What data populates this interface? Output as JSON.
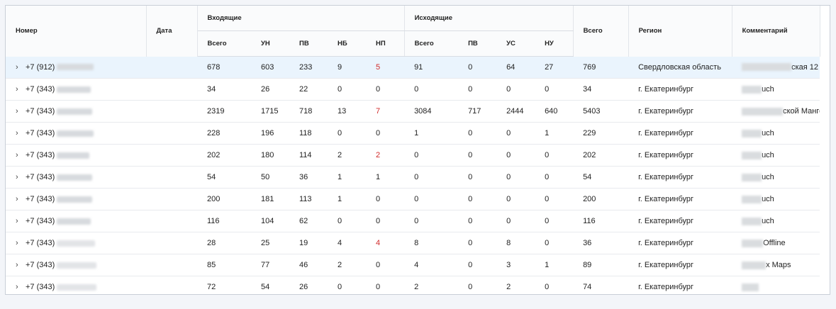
{
  "columns": {
    "number": "Номер",
    "date": "Дата",
    "incoming": "Входящие",
    "outgoing": "Исходящие",
    "total": "Всего",
    "region": "Регион",
    "comment": "Комментарий",
    "in_sub": [
      "Всего",
      "УН",
      "ПВ",
      "НБ",
      "НП"
    ],
    "out_sub": [
      "Всего",
      "ПВ",
      "УС",
      "НУ"
    ]
  },
  "rows": [
    {
      "phone": "+7 (912)",
      "in": [
        "678",
        "603",
        "233",
        "9",
        "5"
      ],
      "in_np_red": true,
      "out": [
        "91",
        "0",
        "64",
        "27"
      ],
      "total": "769",
      "region": "Свердловская область",
      "comment": "ская 12",
      "selected": true
    },
    {
      "phone": "+7 (343)",
      "in": [
        "34",
        "26",
        "22",
        "0",
        "0"
      ],
      "in_np_red": false,
      "out": [
        "0",
        "0",
        "0",
        "0"
      ],
      "total": "34",
      "region": "г. Екатеринбург",
      "comment": "uch",
      "selected": false
    },
    {
      "phone": "+7 (343)",
      "in": [
        "2319",
        "1715",
        "718",
        "13",
        "7"
      ],
      "in_np_red": true,
      "out": [
        "3084",
        "717",
        "2444",
        "640"
      ],
      "total": "5403",
      "region": "г. Екатеринбург",
      "comment": "ской Манго",
      "selected": false
    },
    {
      "phone": "+7 (343)",
      "in": [
        "228",
        "196",
        "118",
        "0",
        "0"
      ],
      "in_np_red": false,
      "out": [
        "1",
        "0",
        "0",
        "1"
      ],
      "total": "229",
      "region": "г. Екатеринбург",
      "comment": "uch",
      "selected": false
    },
    {
      "phone": "+7 (343)",
      "in": [
        "202",
        "180",
        "114",
        "2",
        "2"
      ],
      "in_np_red": true,
      "out": [
        "0",
        "0",
        "0",
        "0"
      ],
      "total": "202",
      "region": "г. Екатеринбург",
      "comment": "uch",
      "selected": false
    },
    {
      "phone": "+7 (343)",
      "in": [
        "54",
        "50",
        "36",
        "1",
        "1"
      ],
      "in_np_red": false,
      "out": [
        "0",
        "0",
        "0",
        "0"
      ],
      "total": "54",
      "region": "г. Екатеринбург",
      "comment": "uch",
      "selected": false
    },
    {
      "phone": "+7 (343)",
      "in": [
        "200",
        "181",
        "113",
        "1",
        "0"
      ],
      "in_np_red": false,
      "out": [
        "0",
        "0",
        "0",
        "0"
      ],
      "total": "200",
      "region": "г. Екатеринбург",
      "comment": "uch",
      "selected": false
    },
    {
      "phone": "+7 (343)",
      "in": [
        "116",
        "104",
        "62",
        "0",
        "0"
      ],
      "in_np_red": false,
      "out": [
        "0",
        "0",
        "0",
        "0"
      ],
      "total": "116",
      "region": "г. Екатеринбург",
      "comment": "uch",
      "selected": false
    },
    {
      "phone": "+7 (343)",
      "in": [
        "28",
        "25",
        "19",
        "4",
        "4"
      ],
      "in_np_red": true,
      "out": [
        "8",
        "0",
        "8",
        "0"
      ],
      "total": "36",
      "region": "г. Екатеринбург",
      "comment": "Offline",
      "selected": false
    },
    {
      "phone": "+7 (343)",
      "in": [
        "85",
        "77",
        "46",
        "2",
        "0"
      ],
      "in_np_red": false,
      "out": [
        "4",
        "0",
        "3",
        "1"
      ],
      "total": "89",
      "region": "г. Екатеринбург",
      "comment": "x Maps",
      "selected": false
    },
    {
      "phone": "+7 (343)",
      "in": [
        "72",
        "54",
        "26",
        "0",
        "0"
      ],
      "in_np_red": false,
      "out": [
        "2",
        "0",
        "2",
        "0"
      ],
      "total": "74",
      "region": "г. Екатеринбург",
      "comment": "",
      "selected": false
    }
  ]
}
